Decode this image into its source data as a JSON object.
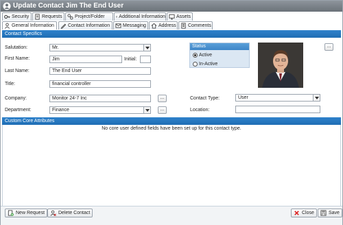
{
  "window": {
    "title": "Update Contact Jim The End User"
  },
  "tabs_row1": [
    {
      "label": "Security"
    },
    {
      "label": "Requests"
    },
    {
      "label": "Project/Folder"
    },
    {
      "label": "Additional Information"
    },
    {
      "label": "Assets"
    }
  ],
  "tabs_row2": [
    {
      "label": "General Information"
    },
    {
      "label": "Contact Information"
    },
    {
      "label": "Messaging"
    },
    {
      "label": "Address"
    },
    {
      "label": "Comments"
    }
  ],
  "sections": {
    "contact_specifics": "Contact Specifics",
    "custom_core": "Custom Core Attributes"
  },
  "form": {
    "salutation_label": "Salutation:",
    "salutation_value": "Mr.",
    "first_name_label": "First Name:",
    "first_name_value": "Jim",
    "initial_label": "Initial:",
    "initial_value": "",
    "last_name_label": "Last Name:",
    "last_name_value": "The End User",
    "title_label": "Title:",
    "title_value": "financial controller",
    "company_label": "Company:",
    "company_value": "Monitor 24-7 Inc",
    "department_label": "Department:",
    "department_value": "Finance",
    "contact_type_label": "Contact Type:",
    "contact_type_value": "User",
    "location_label": "Location:",
    "location_value": "",
    "dots": "..."
  },
  "status": {
    "header": "Status",
    "active_label": "Active",
    "inactive_label": "In-Active",
    "selected": "Active"
  },
  "custom_note": "No core user defined fields have been set up for this contact type.",
  "footer": {
    "new_request": "New Request",
    "delete_contact": "Delete Contact",
    "close": "Close",
    "save": "Save"
  },
  "colors": {
    "accent": "#1f6db4",
    "titlebar": "#7b8289",
    "status_bg": "#dbe7f3"
  }
}
